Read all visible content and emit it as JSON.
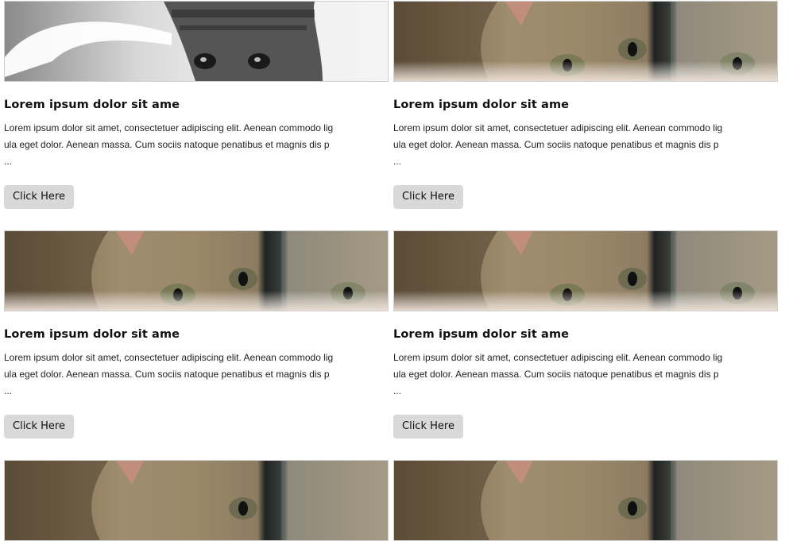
{
  "cards": [
    {
      "title": "Lorem ipsum dolor sit ame",
      "text": "Lorem ipsum dolor sit amet, consectetuer adipiscing elit. Aenean commodo ligula eget dolor. Aenean massa. Cum sociis natoque penatibus et magnis dis p ...",
      "button": "Click Here",
      "image": "grayscale-kitten"
    },
    {
      "title": "Lorem ipsum dolor sit ame",
      "text": "Lorem ipsum dolor sit amet, consectetuer adipiscing elit. Aenean commodo ligula eget dolor. Aenean massa. Cum sociis natoque penatibus et magnis dis p ...",
      "button": "Click Here",
      "image": "tabby-kitten-eyes"
    },
    {
      "title": "Lorem ipsum dolor sit ame",
      "text": "Lorem ipsum dolor sit amet, consectetuer adipiscing elit. Aenean commodo ligula eget dolor. Aenean massa. Cum sociis natoque penatibus et magnis dis p ...",
      "button": "Click Here",
      "image": "tabby-kitten-eyes"
    },
    {
      "title": "Lorem ipsum dolor sit ame",
      "text": "Lorem ipsum dolor sit amet, consectetuer adipiscing elit. Aenean commodo ligula eget dolor. Aenean massa. Cum sociis natoque penatibus et magnis dis p ...",
      "button": "Click Here",
      "image": "tabby-kitten-eyes"
    },
    {
      "title": "",
      "text": "",
      "button": "",
      "image": "tabby-kitten-eyes"
    },
    {
      "title": "",
      "text": "",
      "button": "",
      "image": "tabby-kitten-eyes"
    }
  ]
}
